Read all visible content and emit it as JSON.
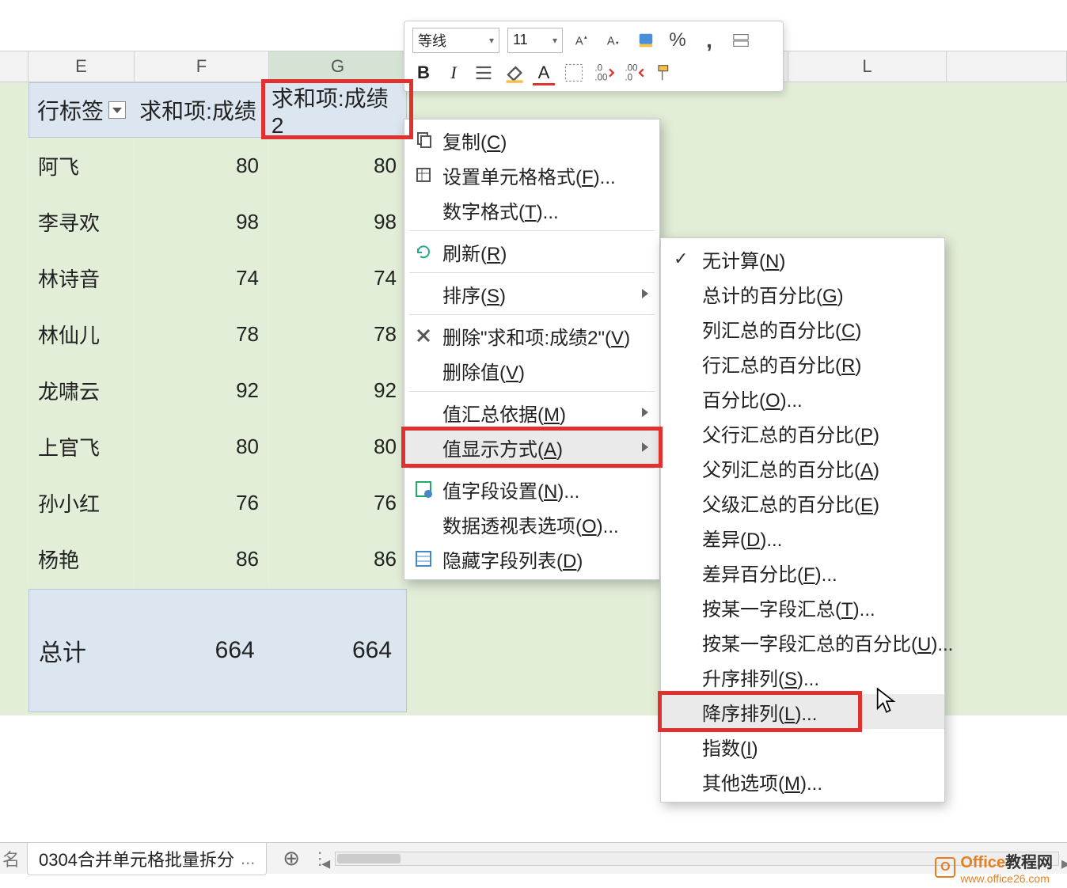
{
  "columns": [
    "E",
    "F",
    "G",
    "L"
  ],
  "headers": {
    "row_label": "行标签",
    "sum1": "求和项:成绩",
    "sum2": "求和项:成绩2"
  },
  "rows": [
    {
      "name": "阿飞",
      "v1": "80",
      "v2": "80"
    },
    {
      "name": "李寻欢",
      "v1": "98",
      "v2": "98"
    },
    {
      "name": "林诗音",
      "v1": "74",
      "v2": "74"
    },
    {
      "name": "林仙儿",
      "v1": "78",
      "v2": "78"
    },
    {
      "name": "龙啸云",
      "v1": "92",
      "v2": "92"
    },
    {
      "name": "上官飞",
      "v1": "80",
      "v2": "80"
    },
    {
      "name": "孙小红",
      "v1": "76",
      "v2": "76"
    },
    {
      "name": "杨艳",
      "v1": "86",
      "v2": "86"
    }
  ],
  "total": {
    "label": "总计",
    "v1": "664",
    "v2": "664"
  },
  "mini_toolbar": {
    "font": "等线",
    "size": "11",
    "bold": "B",
    "italic": "I",
    "percent": "%",
    "comma": ",",
    "A": "A"
  },
  "context_menu": [
    {
      "icon": "copy",
      "label": "复制",
      "mn": "C"
    },
    {
      "icon": "format",
      "label": "设置单元格格式",
      "mn": "F",
      "dots": true
    },
    {
      "label": "数字格式",
      "mn": "T",
      "dots": true
    },
    {
      "sep": true
    },
    {
      "icon": "refresh",
      "label": "刷新",
      "mn": "R"
    },
    {
      "sep": true
    },
    {
      "label": "排序",
      "mn": "S",
      "sub": true
    },
    {
      "sep": true
    },
    {
      "icon": "delete",
      "label": "删除\"求和项:成绩2\"",
      "mn": "V"
    },
    {
      "label": "删除值",
      "mn": "V"
    },
    {
      "sep": true
    },
    {
      "label": "值汇总依据",
      "mn": "M",
      "sub": true
    },
    {
      "label": "值显示方式",
      "mn": "A",
      "sub": true,
      "hover": true,
      "highlight": true
    },
    {
      "sep": true
    },
    {
      "icon": "field",
      "label": "值字段设置",
      "mn": "N",
      "dots": true
    },
    {
      "label": "数据透视表选项",
      "mn": "O",
      "dots": true
    },
    {
      "icon": "hide",
      "label": "隐藏字段列表",
      "mn": "D"
    }
  ],
  "submenu": [
    {
      "label": "无计算",
      "mn": "N",
      "check": true
    },
    {
      "label": "总计的百分比",
      "mn": "G"
    },
    {
      "label": "列汇总的百分比",
      "mn": "C"
    },
    {
      "label": "行汇总的百分比",
      "mn": "R"
    },
    {
      "label": "百分比",
      "mn": "O",
      "dots": true
    },
    {
      "label": "父行汇总的百分比",
      "mn": "P"
    },
    {
      "label": "父列汇总的百分比",
      "mn": "A"
    },
    {
      "label": "父级汇总的百分比",
      "mn": "E"
    },
    {
      "label": "差异",
      "mn": "D",
      "dots": true
    },
    {
      "label": "差异百分比",
      "mn": "F",
      "dots": true
    },
    {
      "label": "按某一字段汇总",
      "mn": "T",
      "dots": true
    },
    {
      "label": "按某一字段汇总的百分比",
      "mn": "U",
      "dots": true
    },
    {
      "label": "升序排列",
      "mn": "S",
      "dots": true
    },
    {
      "label": "降序排列",
      "mn": "L",
      "dots": true,
      "hover": true,
      "highlight": true
    },
    {
      "label": "指数",
      "mn": "I"
    },
    {
      "label": "其他选项",
      "mn": "M",
      "dots": true
    }
  ],
  "tab": {
    "name": "0304合并单元格批量拆分",
    "ell": "..."
  },
  "stub": "名",
  "watermark": {
    "brand": "Office",
    "suffix": "教程网",
    "url": "www.office26.com",
    "logo": "O"
  }
}
